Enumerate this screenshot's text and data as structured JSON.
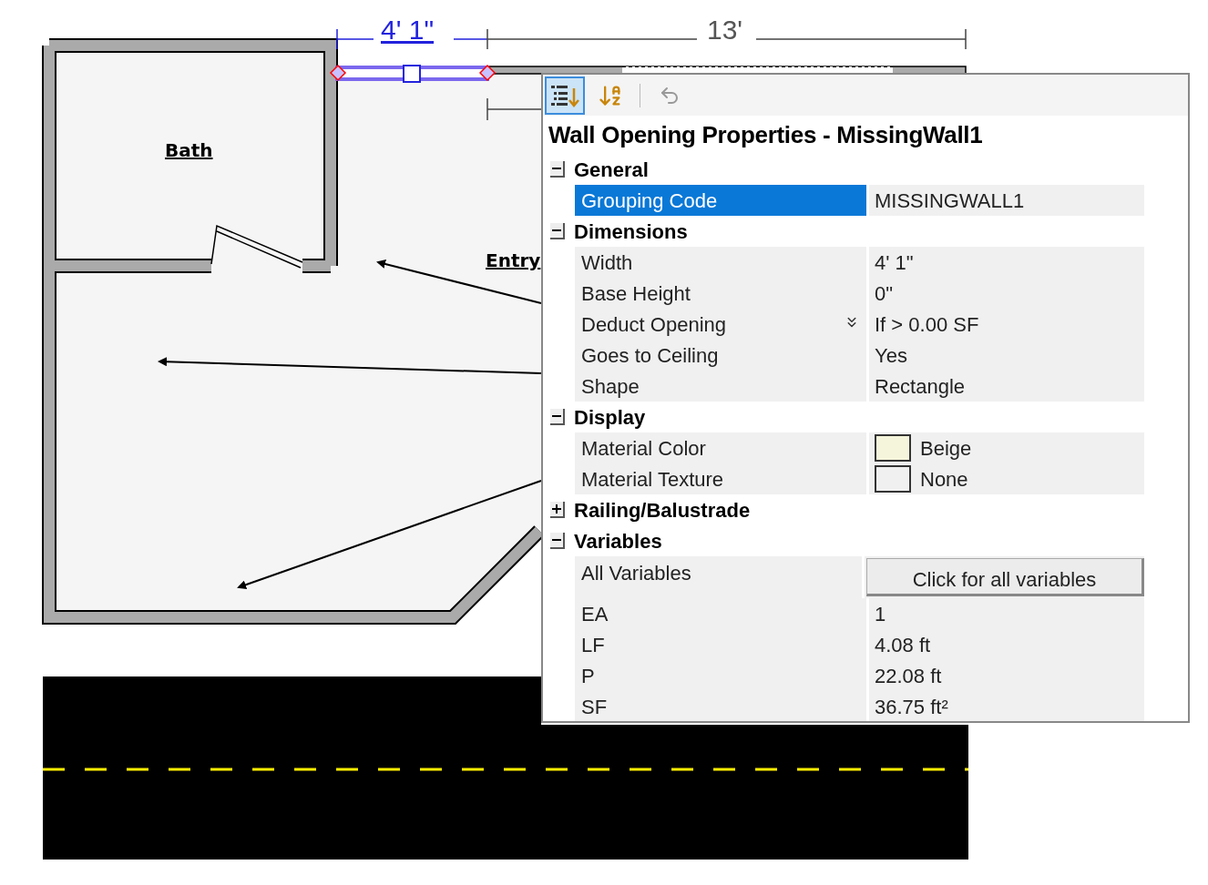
{
  "plan": {
    "labels": [
      {
        "text": "4' 1\"",
        "kind": "dimension_selected"
      },
      {
        "text": "13'",
        "kind": "dimension"
      },
      {
        "text": "Bath",
        "kind": "room"
      },
      {
        "text": "Entry",
        "kind": "room"
      }
    ]
  },
  "panel": {
    "toolbar": [
      {
        "kind": "categorized",
        "selected": true
      },
      {
        "kind": "alphabetical",
        "selected": false
      },
      {
        "kind": "undo",
        "selected": false
      }
    ],
    "title": "Wall Opening Properties - MissingWall1",
    "sections": [
      {
        "name": "General",
        "expanded": true,
        "rows": [
          {
            "label": "Grouping Code",
            "value": "MISSINGWALL1",
            "kind": "text",
            "selected": true
          }
        ]
      },
      {
        "name": "Dimensions",
        "expanded": true,
        "rows": [
          {
            "label": "Width",
            "value": "4' 1\"",
            "kind": "text",
            "selected": false
          },
          {
            "label": "Base Height",
            "value": "0\"",
            "kind": "text",
            "selected": false
          },
          {
            "label": "Deduct Opening",
            "value": "If > 0.00 SF",
            "kind": "dropdown",
            "selected": false
          },
          {
            "label": "Goes to Ceiling",
            "value": "Yes",
            "kind": "text",
            "selected": false
          },
          {
            "label": "Shape",
            "value": "Rectangle",
            "kind": "text",
            "selected": false
          }
        ]
      },
      {
        "name": "Display",
        "expanded": true,
        "rows": [
          {
            "label": "Material Color",
            "value": "Beige",
            "kind": "swatch",
            "color": "#f5f5dc",
            "selected": false
          },
          {
            "label": "Material Texture",
            "value": "None",
            "kind": "swatch",
            "color": "#f0f0f0",
            "selected": false
          }
        ]
      },
      {
        "name": "Railing/Balustrade",
        "expanded": false
      },
      {
        "name": "Variables",
        "expanded": true,
        "rows": [
          {
            "label": "All Variables",
            "value": "Click for all variables",
            "kind": "button",
            "selected": false
          },
          {
            "label": "EA",
            "value": "1",
            "kind": "text",
            "selected": false
          },
          {
            "label": "LF",
            "value": "4.08 ft",
            "kind": "text",
            "selected": false
          },
          {
            "label": "P",
            "value": "22.08 ft",
            "kind": "text",
            "selected": false
          },
          {
            "label": "SF",
            "value": "36.75 ft²",
            "kind": "text",
            "selected": false
          }
        ]
      }
    ]
  }
}
